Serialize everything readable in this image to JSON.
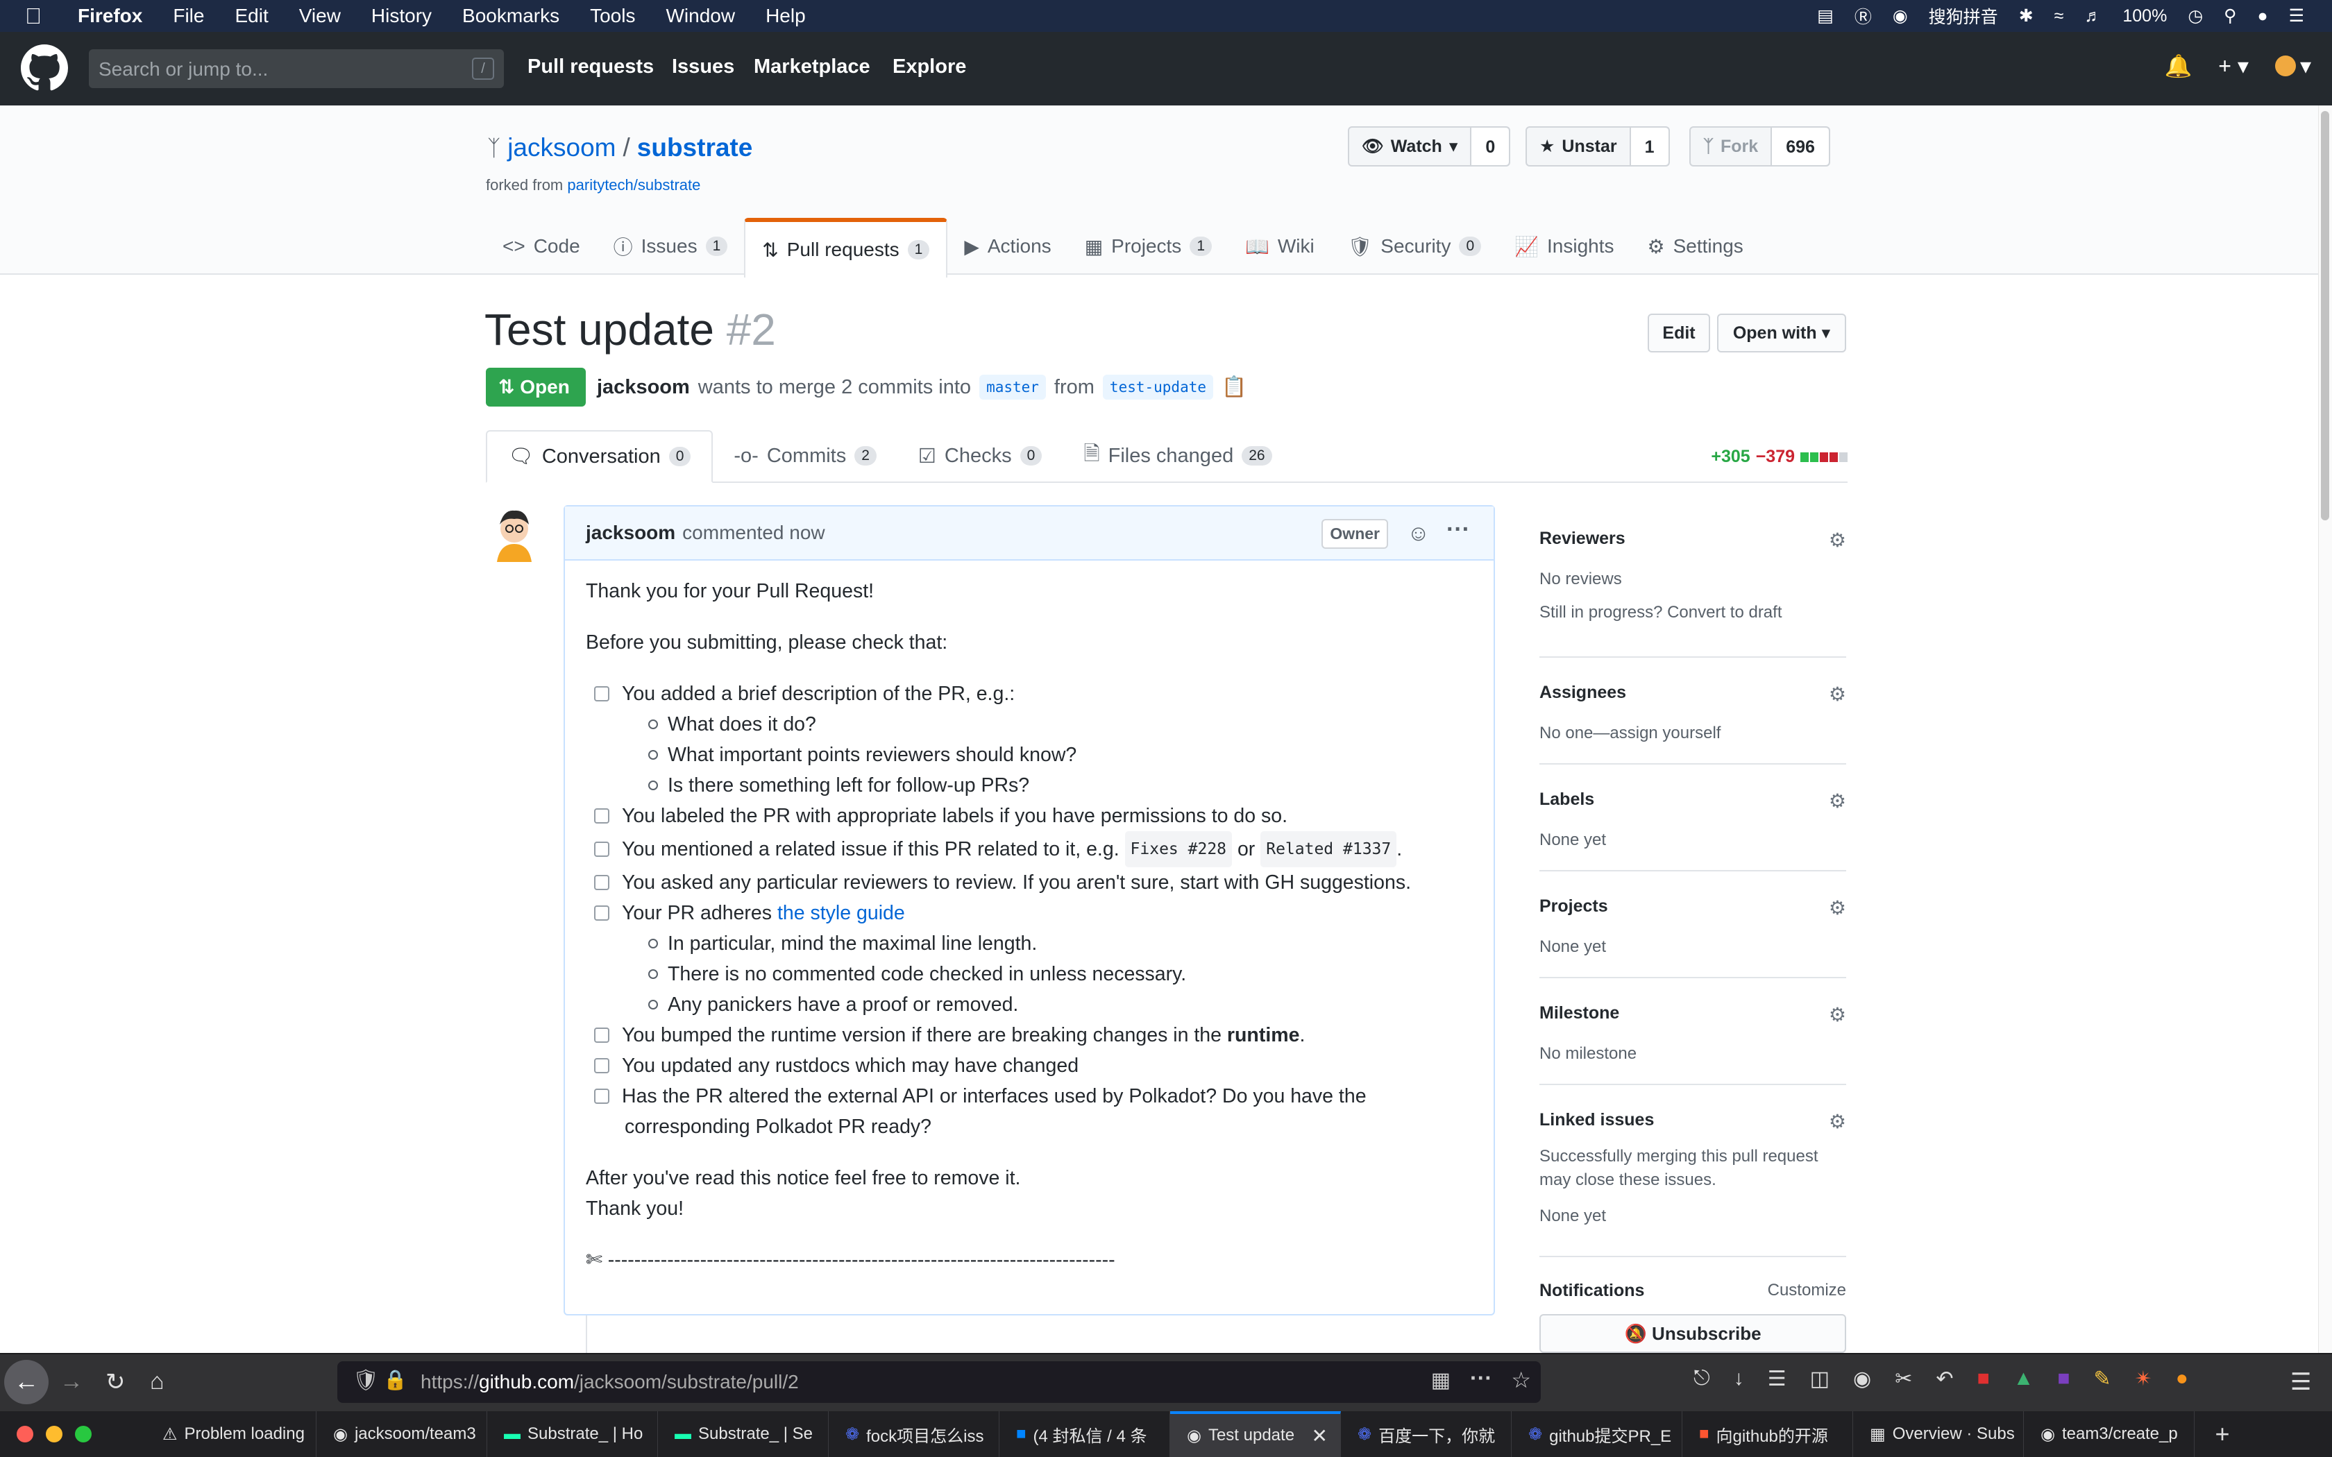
{
  "mac_menu": {
    "app": "Firefox",
    "items": [
      "File",
      "Edit",
      "View",
      "History",
      "Bookmarks",
      "Tools",
      "Window",
      "Help"
    ],
    "ime": "搜狗拼音",
    "battery": "100%"
  },
  "github_header": {
    "search_placeholder": "Search or jump to...",
    "search_hint": "/",
    "nav": [
      "Pull requests",
      "Issues",
      "Marketplace",
      "Explore"
    ]
  },
  "repo": {
    "owner": "jacksoom",
    "separator": "/",
    "name": "substrate",
    "forked_from_label": "forked from",
    "forked_from": "paritytech/substrate",
    "watch_label": "Watch",
    "watch_count": "0",
    "star_label": "Unstar",
    "star_count": "1",
    "fork_label": "Fork",
    "fork_count": "696",
    "tabs": [
      {
        "label": "Code",
        "count": ""
      },
      {
        "label": "Issues",
        "count": "1"
      },
      {
        "label": "Pull requests",
        "count": "1"
      },
      {
        "label": "Actions",
        "count": ""
      },
      {
        "label": "Projects",
        "count": "1"
      },
      {
        "label": "Wiki",
        "count": ""
      },
      {
        "label": "Security",
        "count": "0"
      },
      {
        "label": "Insights",
        "count": ""
      },
      {
        "label": "Settings",
        "count": ""
      }
    ]
  },
  "pr": {
    "title": "Test update",
    "number": "#2",
    "edit_label": "Edit",
    "open_with_label": "Open with",
    "state": "Open",
    "author": "jacksoom",
    "merge_text": "wants to merge 2 commits into",
    "base": "master",
    "from_text": "from",
    "head": "test-update",
    "tabs": [
      {
        "label": "Conversation",
        "count": "0"
      },
      {
        "label": "Commits",
        "count": "2"
      },
      {
        "label": "Checks",
        "count": "0"
      },
      {
        "label": "Files changed",
        "count": "26"
      }
    ],
    "additions": "+305",
    "deletions": "−379"
  },
  "comment": {
    "author": "jacksoom",
    "time": "commented now",
    "role": "Owner",
    "intro": "Thank you for your Pull Request!",
    "before": "Before you submitting, please check that:",
    "c1": "You added a brief description of the PR, e.g.:",
    "c1a": "What does it do?",
    "c1b": "What important points reviewers should know?",
    "c1c": "Is there something left for follow-up PRs?",
    "c2": "You labeled the PR with appropriate labels if you have permissions to do so.",
    "c3_pre": "You mentioned a related issue if this PR related to it, e.g.",
    "c3_code1": "Fixes #228",
    "c3_or": "or",
    "c3_code2": "Related #1337",
    "c3_end": ".",
    "c4": "You asked any particular reviewers to review. If you aren't sure, start with GH suggestions.",
    "c5_pre": "Your PR adheres",
    "c5_link": "the style guide",
    "c5a": "In particular, mind the maximal line length.",
    "c5b": "There is no commented code checked in unless necessary.",
    "c5c": "Any panickers have a proof or removed.",
    "c6_pre": "You bumped the runtime version if there are breaking changes in the",
    "c6_bold": "runtime",
    "c6_end": ".",
    "c7": "You updated any rustdocs which may have changed",
    "c8a": "Has the PR altered the external API or interfaces used by Polkadot? Do you have the",
    "c8b": "corresponding Polkadot PR ready?",
    "after1": "After you've read this notice feel free to remove it.",
    "after2": "Thank you!",
    "scissors": "✄ -----------------------------------------------------------------------------"
  },
  "sidebar": {
    "reviewers_h": "Reviewers",
    "reviewers_v": "No reviews",
    "reviewers_draft": "Still in progress? Convert to draft",
    "assignees_h": "Assignees",
    "assignees_v": "No one—assign yourself",
    "labels_h": "Labels",
    "labels_v": "None yet",
    "projects_h": "Projects",
    "projects_v": "None yet",
    "milestone_h": "Milestone",
    "milestone_v": "No milestone",
    "linked_h": "Linked issues",
    "linked_v1": "Successfully merging this pull request",
    "linked_v2": "may close these issues.",
    "linked_v3": "None yet",
    "notif_h": "Notifications",
    "notif_customize": "Customize",
    "unsubscribe": "Unsubscribe"
  },
  "browser": {
    "url_prefix": "https://",
    "url_domain": "github.com",
    "url_path": "/jacksoom/substrate/pull/2",
    "tabs": [
      "Problem loading",
      "jacksoom/team3",
      "Substrate_ | Ho",
      "Substrate_ | Se",
      "fock项目怎么iss",
      "(4 封私信 / 4 条",
      "Test update",
      "百度一下，你就",
      "github提交PR_E",
      "向github的开源",
      "Overview · Subs",
      "team3/create_p"
    ]
  }
}
